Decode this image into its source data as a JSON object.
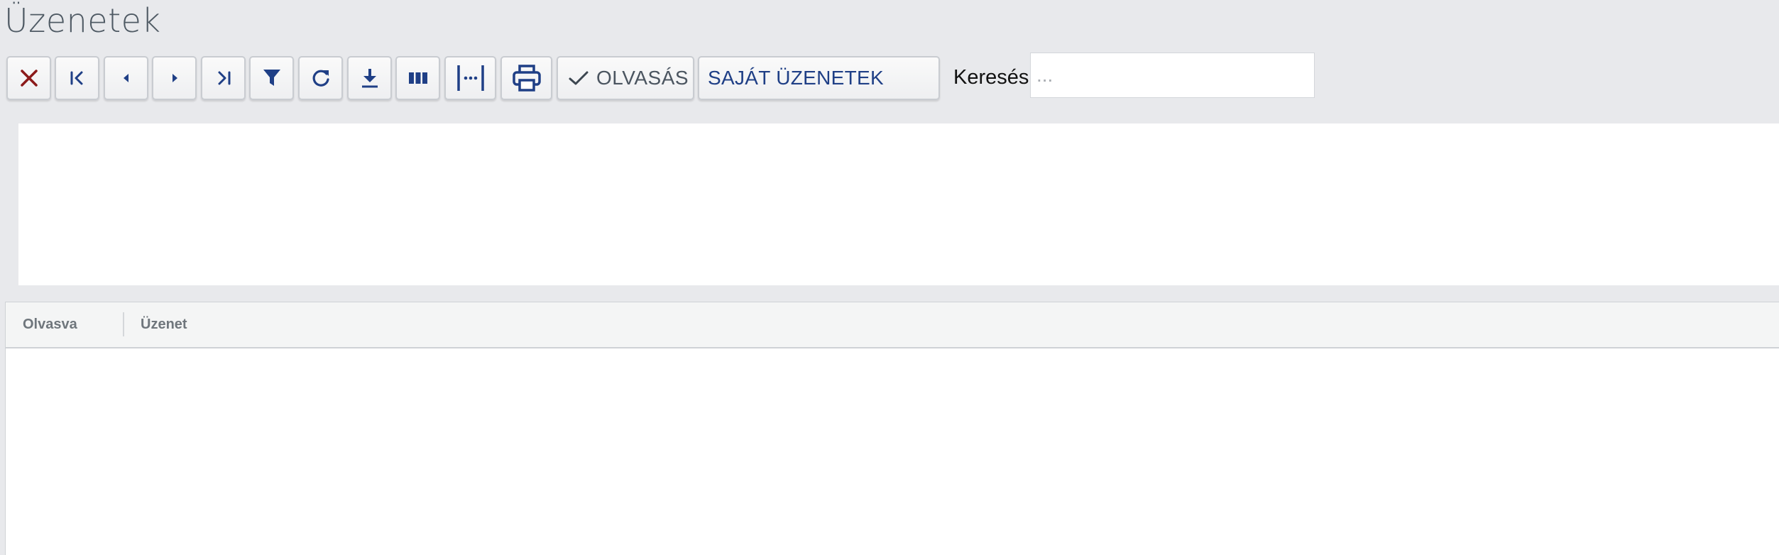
{
  "page": {
    "title": "Üzenetek"
  },
  "toolbar": {
    "buttons": [
      {
        "name": "close-button",
        "icon": "close-icon"
      },
      {
        "name": "first-page-button",
        "icon": "first-page-icon"
      },
      {
        "name": "prev-button",
        "icon": "caret-left-icon"
      },
      {
        "name": "next-button",
        "icon": "caret-right-icon"
      },
      {
        "name": "last-page-button",
        "icon": "last-page-icon"
      },
      {
        "name": "filter-button",
        "icon": "filter-icon"
      },
      {
        "name": "refresh-button",
        "icon": "refresh-icon"
      },
      {
        "name": "download-button",
        "icon": "download-icon"
      },
      {
        "name": "columns-button",
        "icon": "columns-icon"
      },
      {
        "name": "fit-width-button",
        "icon": "fit-width-icon"
      },
      {
        "name": "print-button",
        "icon": "print-icon"
      }
    ],
    "olvasas_label": "OLVASÁS",
    "sajat_label": "SAJÁT ÜZENETEK"
  },
  "search": {
    "label": "Keresés:",
    "placeholder": "...",
    "value": ""
  },
  "grid": {
    "columns": [
      "Olvasva",
      "Üzenet"
    ],
    "rows": []
  },
  "colors": {
    "icon_blue": "#1f3f86",
    "close_red": "#8b1a1a",
    "background": "#e8e9ec"
  }
}
